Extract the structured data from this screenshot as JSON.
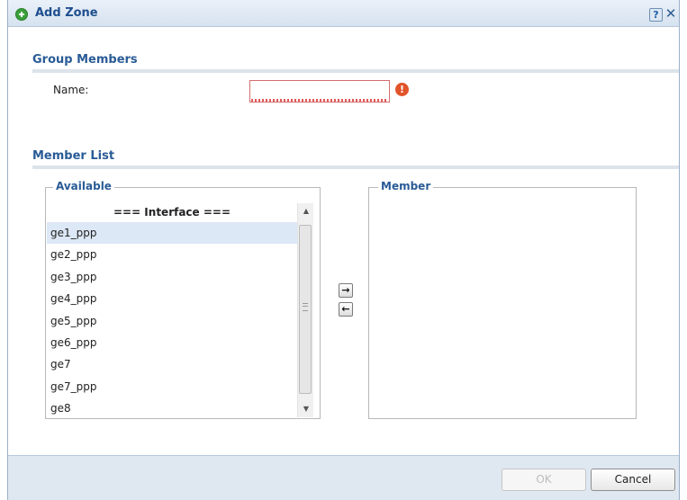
{
  "window": {
    "title": "Add Zone",
    "help_label": "?",
    "close_label": "✕"
  },
  "group_members": {
    "section_title": "Group Members",
    "name_label": "Name:",
    "name_value": "",
    "name_error_glyph": "!"
  },
  "member_list": {
    "section_title": "Member List",
    "available_legend": "Available",
    "member_legend": "Member",
    "available_header": "=== Interface ===",
    "available_items": [
      "ge1_ppp",
      "ge2_ppp",
      "ge3_ppp",
      "ge4_ppp",
      "ge5_ppp",
      "ge6_ppp",
      "ge7",
      "ge7_ppp",
      "ge8"
    ],
    "selected_item": "ge1_ppp",
    "member_items": [],
    "add_arrow": "→",
    "remove_arrow": "←"
  },
  "footer": {
    "ok_label": "OK",
    "cancel_label": "Cancel"
  },
  "colors": {
    "title_text": "#1e4f8f",
    "section_text": "#2a5b96",
    "error": "#e2542a",
    "selected_row": "#dce8f5",
    "footer_bg": "#dfe7f1"
  },
  "icons": {
    "title_icon": "add-circle-icon",
    "help": "help-icon",
    "close": "close-icon",
    "error": "error-icon"
  }
}
